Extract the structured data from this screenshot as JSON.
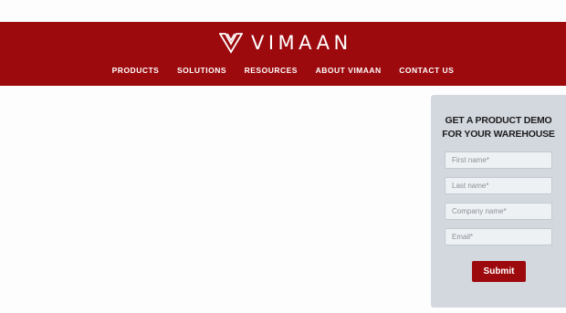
{
  "brand": {
    "name": "VIMAAN",
    "logo_icon": "vimaan-v-logo-icon",
    "color": "#9d0a0e"
  },
  "nav": {
    "items": [
      {
        "label": "PRODUCTS"
      },
      {
        "label": "SOLUTIONS"
      },
      {
        "label": "RESOURCES"
      },
      {
        "label": "ABOUT VIMAAN"
      },
      {
        "label": "CONTACT US"
      }
    ]
  },
  "demo_form": {
    "title_line1": "GET A PRODUCT DEMO",
    "title_line2": "FOR YOUR WAREHOUSE",
    "fields": {
      "first_name_placeholder": "First name*",
      "last_name_placeholder": "Last name*",
      "company_placeholder": "Company name*",
      "email_placeholder": "Email*"
    },
    "submit_label": "Submit"
  }
}
